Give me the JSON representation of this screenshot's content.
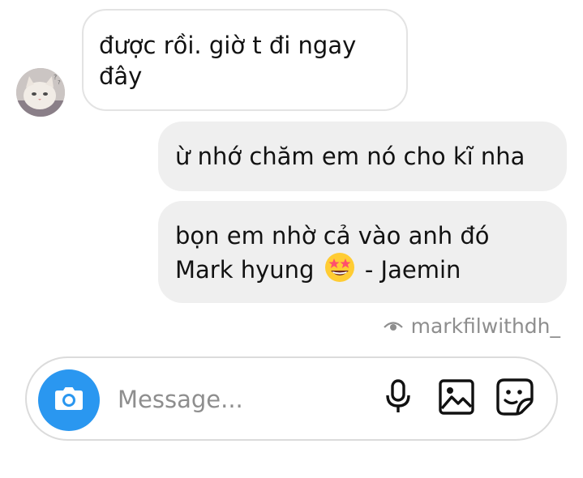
{
  "messages": [
    {
      "direction": "incoming",
      "text": "được rồi. giờ t đi ngay đây"
    },
    {
      "direction": "outgoing",
      "text": "ừ nhớ chăm em nó cho kĩ nha"
    },
    {
      "direction": "outgoing",
      "text_before_emoji": "bọn em nhờ cả vào anh đó Mark hyung",
      "emoji": "star-struck",
      "text_after_emoji": "- Jaemin"
    }
  ],
  "seen_by": "markfilwithdh_",
  "composer": {
    "placeholder": "Message...",
    "value": ""
  },
  "icons": {
    "camera": "camera-icon",
    "mic": "mic-icon",
    "gallery": "gallery-icon",
    "sticker": "sticker-icon",
    "seen": "eye-icon"
  },
  "colors": {
    "camera_button": "#2a97f0",
    "outgoing_bubble": "#efefef",
    "incoming_border": "#e3e3e3",
    "muted_text": "#8e8e8e"
  }
}
